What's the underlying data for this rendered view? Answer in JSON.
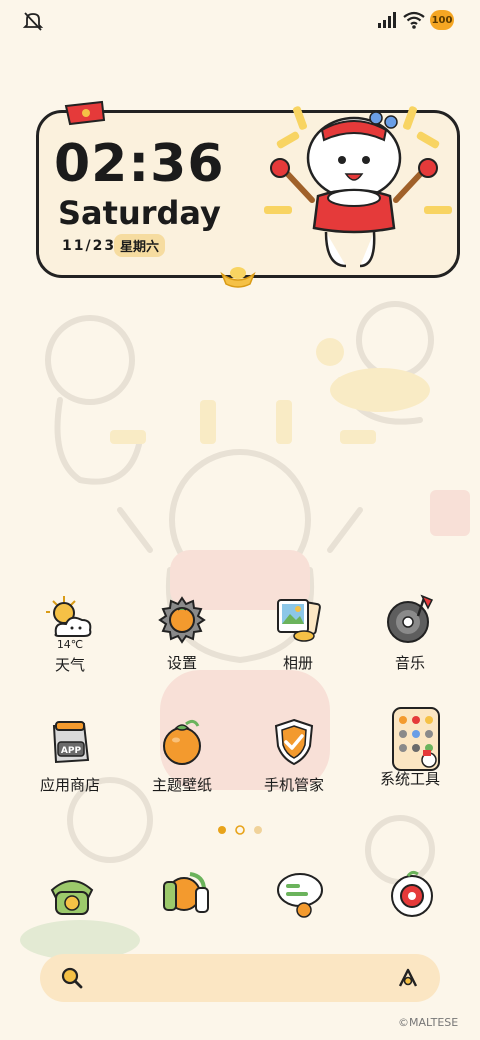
{
  "status_bar": {
    "battery": "100",
    "colors": {
      "battery": "#f5a623"
    }
  },
  "clock_widget": {
    "time": "02:36",
    "day": "Saturday",
    "date": "11/23",
    "weekday": "星期六"
  },
  "weather": {
    "temperature": "14℃"
  },
  "apps": [
    {
      "label": "天气",
      "icon": "weather-icon"
    },
    {
      "label": "设置",
      "icon": "settings-icon"
    },
    {
      "label": "相册",
      "icon": "gallery-icon"
    },
    {
      "label": "音乐",
      "icon": "music-icon"
    },
    {
      "label": "应用商店",
      "icon": "app-store-icon"
    },
    {
      "label": "主题壁纸",
      "icon": "themes-icon"
    },
    {
      "label": "手机管家",
      "icon": "security-icon"
    },
    {
      "label": "系统工具",
      "icon": "system-tools-folder-icon"
    }
  ],
  "dock_apps": [
    {
      "icon": "phone-icon"
    },
    {
      "icon": "contacts-icon"
    },
    {
      "icon": "messages-icon"
    },
    {
      "icon": "camera-icon"
    }
  ],
  "page_indicator": {
    "pages": 3,
    "current": 1
  },
  "watermark": "©MALTESE"
}
